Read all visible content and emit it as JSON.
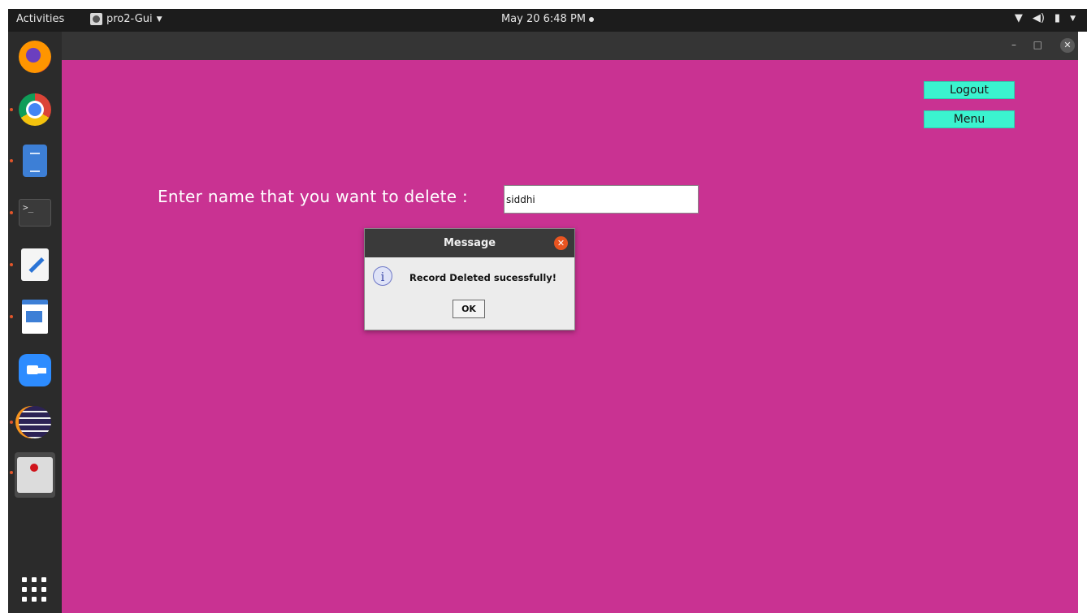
{
  "topbar": {
    "activities": "Activities",
    "app_name": "pro2-Gui",
    "clock": "May 20  6:48 PM"
  },
  "dock": {
    "icons": [
      "firefox-icon",
      "chrome-icon",
      "files-icon",
      "terminal-icon",
      "text-editor-icon",
      "libreoffice-writer-icon",
      "zoom-icon",
      "eclipse-icon",
      "java-app-icon",
      "show-applications-icon"
    ],
    "terminal_glyph": ">_"
  },
  "window": {
    "minimize": "–",
    "maximize": "□",
    "close": "✕"
  },
  "form": {
    "logout_label": "Logout",
    "menu_label": "Menu",
    "prompt": "Enter name that you want to delete :",
    "name_value": "siddhi"
  },
  "dialog": {
    "title": "Message",
    "message": "Record Deleted sucessfully!",
    "ok_label": "OK",
    "info_glyph": "i",
    "close_glyph": "✕"
  },
  "colors": {
    "background": "#c93292",
    "button": "#3bf3cf"
  }
}
